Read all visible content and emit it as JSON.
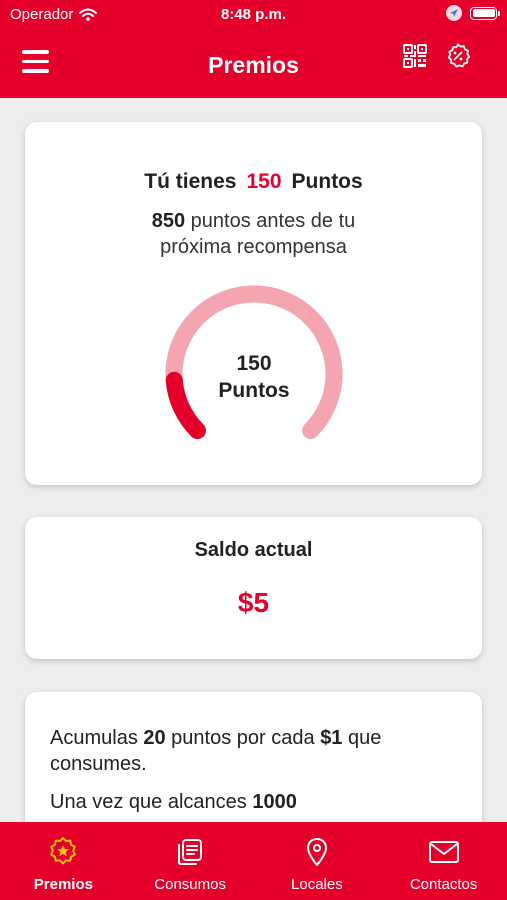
{
  "status_bar": {
    "carrier": "Operador",
    "time": "8:48 p.m."
  },
  "header": {
    "title": "Premios",
    "menu_icon": "hamburger-menu-icon",
    "qr_icon": "qr-code-icon",
    "promo_icon": "discount-badge-icon"
  },
  "points_card": {
    "prefix": "Tú tienes",
    "points": "150",
    "suffix": "Puntos",
    "remaining_points": "850",
    "remaining_text": "puntos antes de tu",
    "remaining_text_2": "próxima recompensa",
    "gauge_value": "150",
    "gauge_unit": "Puntos",
    "gauge_progress": 0.15
  },
  "balance_card": {
    "title": "Saldo actual",
    "amount": "$5"
  },
  "info_card": {
    "line1_a": "Acumulas ",
    "line1_b": "20",
    "line1_c": " puntos por cada ",
    "line1_d": "$1",
    "line1_e": " que consumes.",
    "line2_a": "Una vez que alcances ",
    "line2_b": "1000"
  },
  "tabs": [
    {
      "label": "Premios",
      "icon": "star-badge-icon",
      "active": true
    },
    {
      "label": "Consumos",
      "icon": "receipt-icon",
      "active": false
    },
    {
      "label": "Locales",
      "icon": "location-pin-icon",
      "active": false
    },
    {
      "label": "Contactos",
      "icon": "mail-icon",
      "active": false
    }
  ],
  "colors": {
    "brand": "#e4002b",
    "gauge_track": "#f4a5b0",
    "background": "#ededed"
  }
}
